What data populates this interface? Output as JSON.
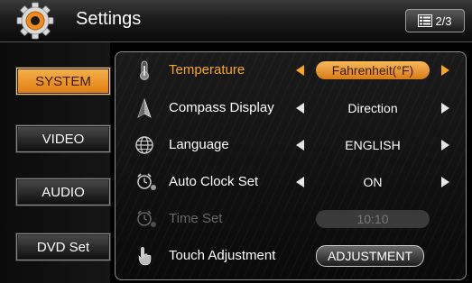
{
  "header": {
    "title": "Settings",
    "page_indicator": "2/3"
  },
  "colors": {
    "accent": "#f5a623",
    "active_tab": "#e88a1a"
  },
  "sidebar": {
    "items": [
      {
        "label": "SYSTEM",
        "active": true
      },
      {
        "label": "VIDEO",
        "active": false
      },
      {
        "label": "AUDIO",
        "active": false
      },
      {
        "label": "DVD Set",
        "active": false
      }
    ]
  },
  "settings": {
    "rows": [
      {
        "label": "Temperature",
        "value": "Fahrenheit(°F)",
        "icon": "thermometer-icon",
        "highlighted": true
      },
      {
        "label": "Compass Display",
        "value": "Direction",
        "icon": "compass-icon"
      },
      {
        "label": "Language",
        "value": "ENGLISH",
        "icon": "globe-icon"
      },
      {
        "label": "Auto Clock Set",
        "value": "ON",
        "icon": "alarm-clock-icon"
      },
      {
        "label": "Time Set",
        "value": "10:10",
        "icon": "alarm-clock-icon",
        "disabled": true
      },
      {
        "label": "Touch Adjustment",
        "value": "ADJUSTMENT",
        "icon": "touch-hand-icon"
      }
    ]
  }
}
